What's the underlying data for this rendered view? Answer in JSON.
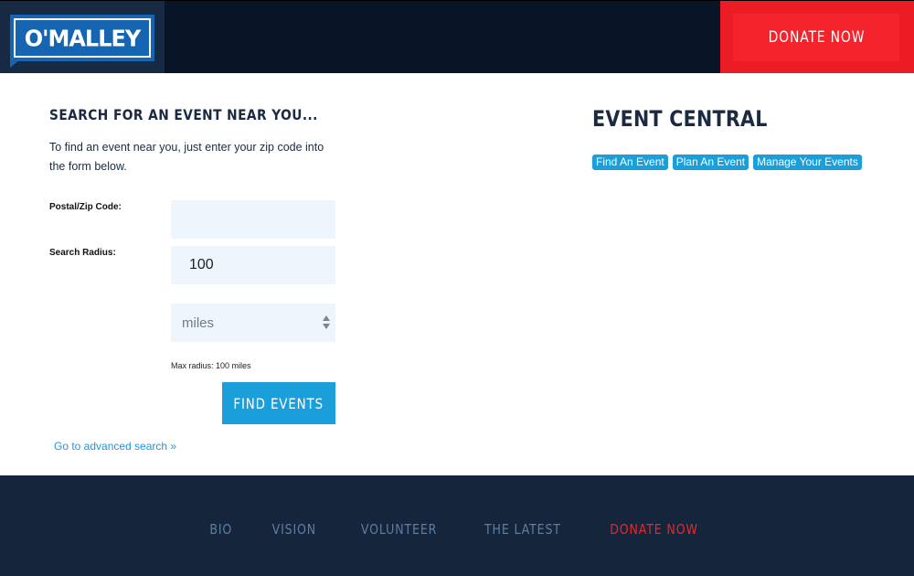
{
  "header": {
    "logo_text": "O'MALLEY",
    "donate_label": "DONATE NOW"
  },
  "search": {
    "title": "SEARCH FOR AN EVENT NEAR YOU...",
    "intro": "To find an event near you, just enter your zip code into the form below.",
    "zip_label": "Postal/Zip Code:",
    "zip_value": "",
    "radius_label": "Search Radius:",
    "radius_value": "100",
    "unit_value": "miles",
    "max_note": "Max radius: 100 miles",
    "submit_label": "FIND EVENTS",
    "advanced_link": "Go to advanced search »"
  },
  "event_central": {
    "title": "EVENT CENTRAL",
    "links": [
      "Find An Event",
      "Plan An Event",
      "Manage Your Events"
    ]
  },
  "footer": {
    "links": [
      "BIO",
      "VISION",
      "VOLUNTEER",
      "THE LATEST",
      "DONATE NOW"
    ]
  },
  "colors": {
    "navy": "#081526",
    "accent_blue": "#1a9fdb",
    "donate_red": "#ec1c24",
    "footer_bg": "#15253c"
  }
}
